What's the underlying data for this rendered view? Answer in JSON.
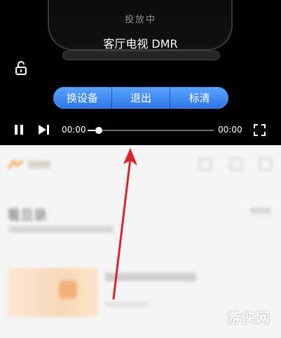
{
  "player": {
    "cast_status": "投放中",
    "device_name": "客厅电视 DMR",
    "buttons": {
      "switch_device": "换设备",
      "exit": "退出",
      "quality": "标清"
    },
    "current_time": "00:00",
    "total_time": "00:00",
    "progress": 0.09
  },
  "icons": {
    "lock": "unlock-icon",
    "pause": "pause-icon",
    "next": "skip-next-icon",
    "fullscreen": "fullscreen-icon"
  },
  "colors": {
    "accent": "#3d86f0",
    "annotation": "#d9232b",
    "player_bg": "#000000"
  },
  "background_page": {
    "title": "看旦录"
  },
  "watermark": "游侠网"
}
